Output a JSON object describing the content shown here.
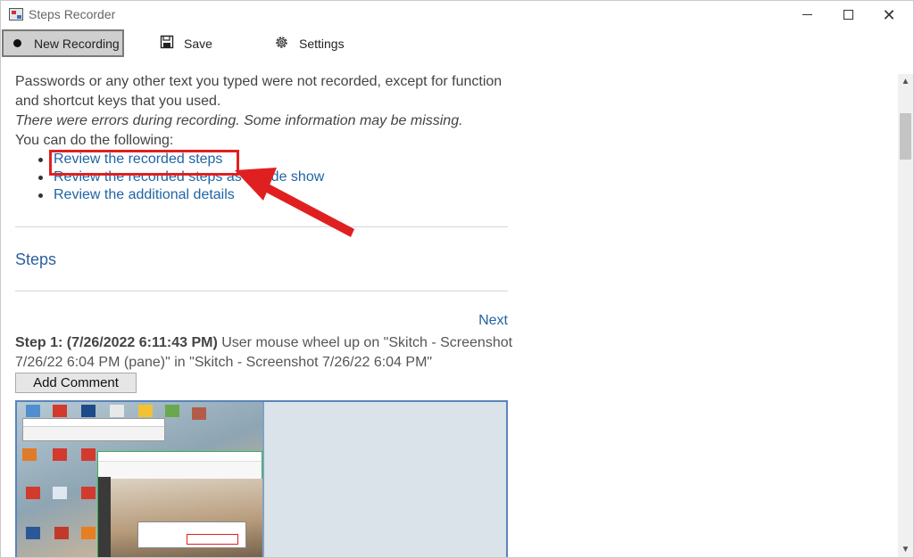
{
  "window": {
    "title": "Steps Recorder"
  },
  "toolbar": {
    "new_recording": "New Recording",
    "save": "Save",
    "settings": "Settings"
  },
  "content": {
    "notice_1": "Passwords or any other text you typed were not recorded, except for function and shortcut keys that you used.",
    "notice_2": "There were errors during recording. Some information may be missing.",
    "notice_3": "You can do the following:",
    "links": [
      "Review the recorded steps",
      "Review the recorded steps as a slide show",
      "Review the additional details"
    ],
    "steps_heading": "Steps",
    "next": "Next",
    "step": {
      "label": "Step 1: (7/26/2022 6:11:43 PM)",
      "description": " User mouse wheel up on \"Skitch - Screenshot 7/26/22 6:04 PM (pane)\" in \"Skitch - Screenshot 7/26/22 6:04 PM\""
    },
    "add_comment": "Add Comment"
  },
  "colors": {
    "link": "#2064a4",
    "heading": "#2d5fa0",
    "highlight": "#e02020",
    "pressed_button": "#cfcfcf"
  },
  "icons": {
    "app": "steps-recorder-icon",
    "record": "record-dot-icon",
    "save": "floppy-disk-icon",
    "settings": "gear-icon"
  }
}
